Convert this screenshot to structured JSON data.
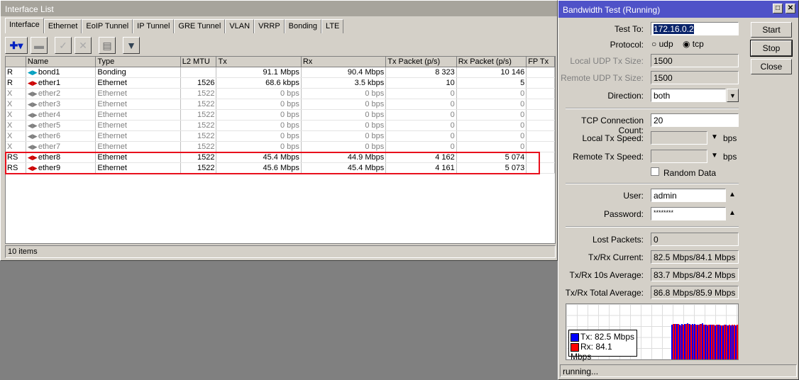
{
  "interface_window": {
    "title": "Interface List",
    "tabs": [
      "Interface",
      "Ethernet",
      "EoIP Tunnel",
      "IP Tunnel",
      "GRE Tunnel",
      "VLAN",
      "VRRP",
      "Bonding",
      "LTE"
    ],
    "columns": [
      "",
      "Name",
      "Type",
      "L2 MTU",
      "Tx",
      "Rx",
      "Tx Packet (p/s)",
      "Rx Packet (p/s)",
      "FP Tx"
    ],
    "rows": [
      {
        "flag": "R",
        "name": "bond1",
        "type": "Bonding",
        "mtu": "",
        "tx": "91.1 Mbps",
        "rx": "90.4 Mbps",
        "txp": "8 323",
        "rxp": "10 146",
        "disabled": false,
        "icon": "bond"
      },
      {
        "flag": "R",
        "name": "ether1",
        "type": "Ethernet",
        "mtu": "1526",
        "tx": "68.6 kbps",
        "rx": "3.5 kbps",
        "txp": "10",
        "rxp": "5",
        "disabled": false,
        "icon": "ether"
      },
      {
        "flag": "X",
        "name": "ether2",
        "type": "Ethernet",
        "mtu": "1522",
        "tx": "0 bps",
        "rx": "0 bps",
        "txp": "0",
        "rxp": "0",
        "disabled": true,
        "icon": "ether"
      },
      {
        "flag": "X",
        "name": "ether3",
        "type": "Ethernet",
        "mtu": "1522",
        "tx": "0 bps",
        "rx": "0 bps",
        "txp": "0",
        "rxp": "0",
        "disabled": true,
        "icon": "ether"
      },
      {
        "flag": "X",
        "name": "ether4",
        "type": "Ethernet",
        "mtu": "1522",
        "tx": "0 bps",
        "rx": "0 bps",
        "txp": "0",
        "rxp": "0",
        "disabled": true,
        "icon": "ether"
      },
      {
        "flag": "X",
        "name": "ether5",
        "type": "Ethernet",
        "mtu": "1522",
        "tx": "0 bps",
        "rx": "0 bps",
        "txp": "0",
        "rxp": "0",
        "disabled": true,
        "icon": "ether"
      },
      {
        "flag": "X",
        "name": "ether6",
        "type": "Ethernet",
        "mtu": "1522",
        "tx": "0 bps",
        "rx": "0 bps",
        "txp": "0",
        "rxp": "0",
        "disabled": true,
        "icon": "ether"
      },
      {
        "flag": "X",
        "name": "ether7",
        "type": "Ethernet",
        "mtu": "1522",
        "tx": "0 bps",
        "rx": "0 bps",
        "txp": "0",
        "rxp": "0",
        "disabled": true,
        "icon": "ether"
      },
      {
        "flag": "RS",
        "name": "ether8",
        "type": "Ethernet",
        "mtu": "1522",
        "tx": "45.4 Mbps",
        "rx": "44.9 Mbps",
        "txp": "4 162",
        "rxp": "5 074",
        "disabled": false,
        "icon": "ether"
      },
      {
        "flag": "RS",
        "name": "ether9",
        "type": "Ethernet",
        "mtu": "1522",
        "tx": "45.6 Mbps",
        "rx": "45.4 Mbps",
        "txp": "4 161",
        "rxp": "5 073",
        "disabled": false,
        "icon": "ether"
      }
    ],
    "status": "10 items"
  },
  "bandwidth_test": {
    "title": "Bandwidth Test (Running)",
    "test_to_label": "Test To:",
    "test_to": "172.16.0.2",
    "protocol_label": "Protocol:",
    "udp": "udp",
    "tcp": "tcp",
    "protocol_selected": "tcp",
    "local_udp_label": "Local UDP Tx Size:",
    "local_udp": "1500",
    "remote_udp_label": "Remote UDP Tx Size:",
    "remote_udp": "1500",
    "direction_label": "Direction:",
    "direction": "both",
    "tcp_count_label": "TCP Connection Count:",
    "tcp_count": "20",
    "local_speed_label": "Local Tx Speed:",
    "remote_speed_label": "Remote Tx Speed:",
    "bps": "bps",
    "random_data": "Random Data",
    "user_label": "User:",
    "user": "admin",
    "password_label": "Password:",
    "password": "********",
    "lost_label": "Lost Packets:",
    "lost": "0",
    "current_label": "Tx/Rx Current:",
    "current": "82.5 Mbps/84.1 Mbps",
    "avg10_label": "Tx/Rx 10s Average:",
    "avg10": "83.7 Mbps/84.2 Mbps",
    "total_label": "Tx/Rx Total Average:",
    "total": "86.8 Mbps/85.9 Mbps",
    "start": "Start",
    "stop": "Stop",
    "close": "Close",
    "legend_tx": "Tx:  82.5 Mbps",
    "legend_rx": "Rx:  84.1 Mbps",
    "status": "running...",
    "colors": {
      "tx": "#0000ff",
      "rx": "#ff0000"
    },
    "graph_tx": [
      85,
      87,
      86,
      85,
      87,
      86,
      88,
      87,
      86,
      86,
      85,
      86,
      88,
      84,
      83,
      84,
      84,
      83,
      84,
      82,
      83,
      84,
      83,
      82,
      83,
      82
    ],
    "graph_rx": [
      86,
      86,
      86,
      83,
      85,
      87,
      86,
      85,
      85,
      84,
      85,
      87,
      85,
      84,
      84,
      84,
      84,
      84,
      85,
      83,
      84,
      83,
      84,
      84,
      84,
      84
    ]
  }
}
